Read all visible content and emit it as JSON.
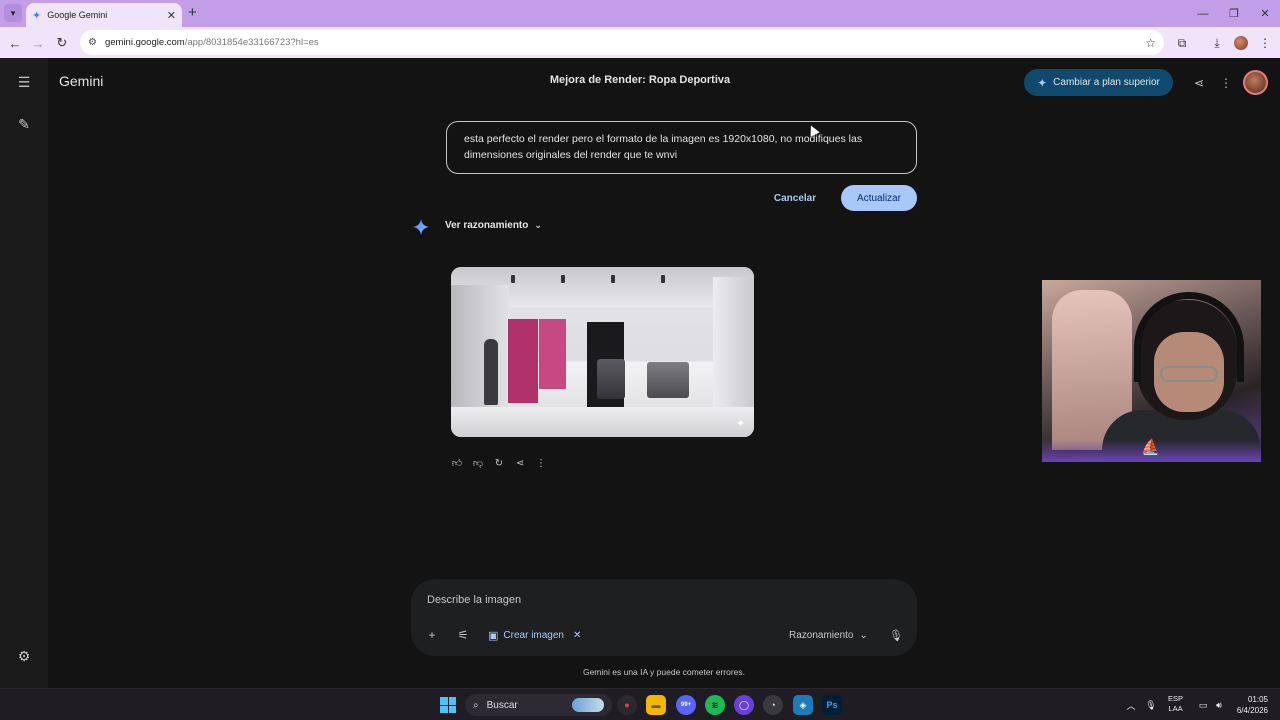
{
  "browser": {
    "tab_title": "Google Gemini",
    "url_host": "gemini.google.com",
    "url_path": "/app/8031854e33166723?hl=es"
  },
  "app": {
    "brand": "Gemini",
    "chat_title": "Mejora de Render: Ropa Deportiva",
    "upgrade_label": "Cambiar a plan superior"
  },
  "edit": {
    "text": "esta perfecto el render pero el formato de la imagen es 1920x1080, no modifiques las dimensiones originales del render que te wnvi",
    "cancel_label": "Cancelar",
    "update_label": "Actualizar"
  },
  "response": {
    "reasoning_toggle": "Ver razonamiento"
  },
  "composer": {
    "placeholder": "Describe la imagen",
    "chip_label": "Crear imagen",
    "mode_label": "Razonamiento"
  },
  "footer": {
    "disclaimer": "Gemini es una IA y puede cometer errores."
  },
  "taskbar": {
    "search_label": "Buscar",
    "lang_top": "ESP",
    "lang_bottom": "LAA",
    "time": "01:05",
    "date": "6/4/2026",
    "discord_badge": "99+",
    "photoshop_label": "Ps"
  },
  "colors": {
    "accent": "#a8c7fa",
    "upgrade_bg": "#0f4a6e",
    "tab_strip": "#c39ee8",
    "app_bg": "#131314"
  }
}
